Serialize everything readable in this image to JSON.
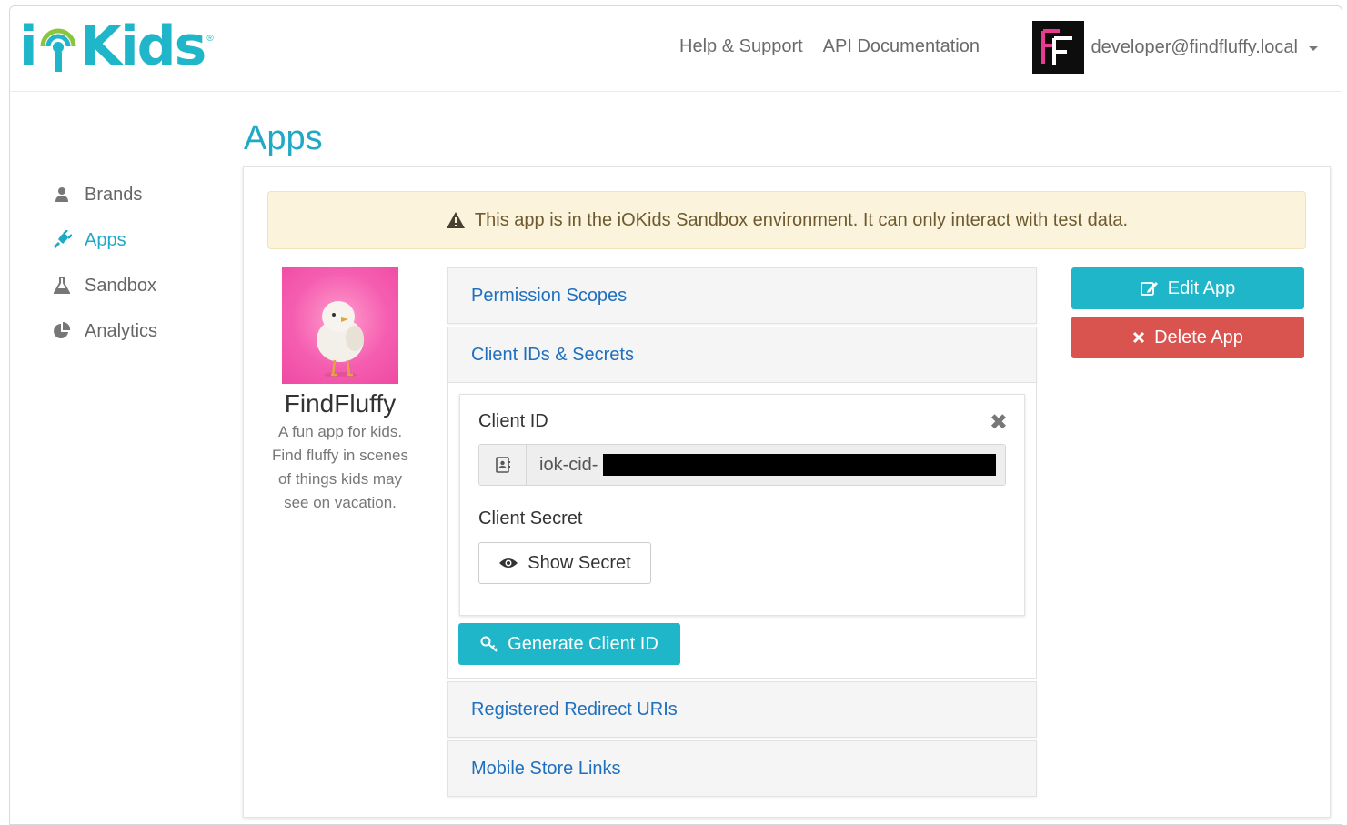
{
  "brand": {
    "logo_prefix": "i",
    "logo_suffix": "Kids",
    "registered_mark": "®",
    "primary_color": "#1fb6c9"
  },
  "header": {
    "links": [
      "Help & Support",
      "API Documentation"
    ],
    "avatar_initials": "FF",
    "user_email": "developer@findfluffy.local"
  },
  "sidebar": {
    "items": [
      {
        "label": "Brands",
        "icon": "user-icon",
        "active": false
      },
      {
        "label": "Apps",
        "icon": "plug-icon",
        "active": true
      },
      {
        "label": "Sandbox",
        "icon": "flask-icon",
        "active": false
      },
      {
        "label": "Analytics",
        "icon": "pie-chart-icon",
        "active": false
      }
    ]
  },
  "page": {
    "title": "Apps"
  },
  "alert": {
    "text": "This app is in the iOKids Sandbox environment. It can only interact with test data.",
    "color": "#fbf3dc"
  },
  "app": {
    "name": "FindFluffy",
    "description": "A fun app for kids. Find fluffy in scenes of things kids may see on vacation."
  },
  "accordion": {
    "sections": [
      "Permission Scopes",
      "Client IDs & Secrets",
      "Registered Redirect URIs",
      "Mobile Store Links"
    ]
  },
  "credentials": {
    "client_id_label": "Client ID",
    "client_id_value": "iok-cid-",
    "client_secret_label": "Client Secret",
    "show_secret_label": "Show Secret",
    "generate_label": "Generate Client ID"
  },
  "actions": {
    "edit_label": "Edit App",
    "delete_label": "Delete App",
    "delete_color": "#d9534f"
  }
}
